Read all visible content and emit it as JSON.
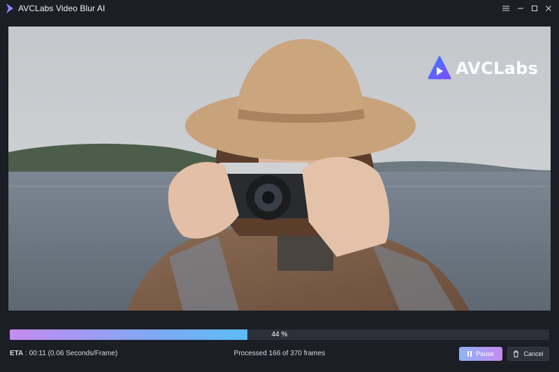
{
  "app": {
    "title": "AVCLabs Video Blur AI"
  },
  "window_controls": {
    "menu_icon": "menu-icon",
    "minimize_icon": "minimize-icon",
    "maximize_icon": "maximize-icon",
    "close_icon": "close-icon"
  },
  "preview": {
    "watermark_text": "AVCLabs",
    "watermark_icon": "avclabs-play-logo-icon"
  },
  "progress": {
    "percent": 44,
    "label": "44 %"
  },
  "status": {
    "eta_label": "ETA",
    "eta_value": " : 00:11 (0.06 Seconds/Frame)",
    "processed_text": "Processed 166 of 370 frames"
  },
  "buttons": {
    "pause_label": "Pause",
    "cancel_label": "Cancel"
  },
  "colors": {
    "background": "#1b1e25",
    "progress_start": "#c58bf0",
    "progress_end": "#5bbcf5",
    "track": "#2d3038"
  }
}
